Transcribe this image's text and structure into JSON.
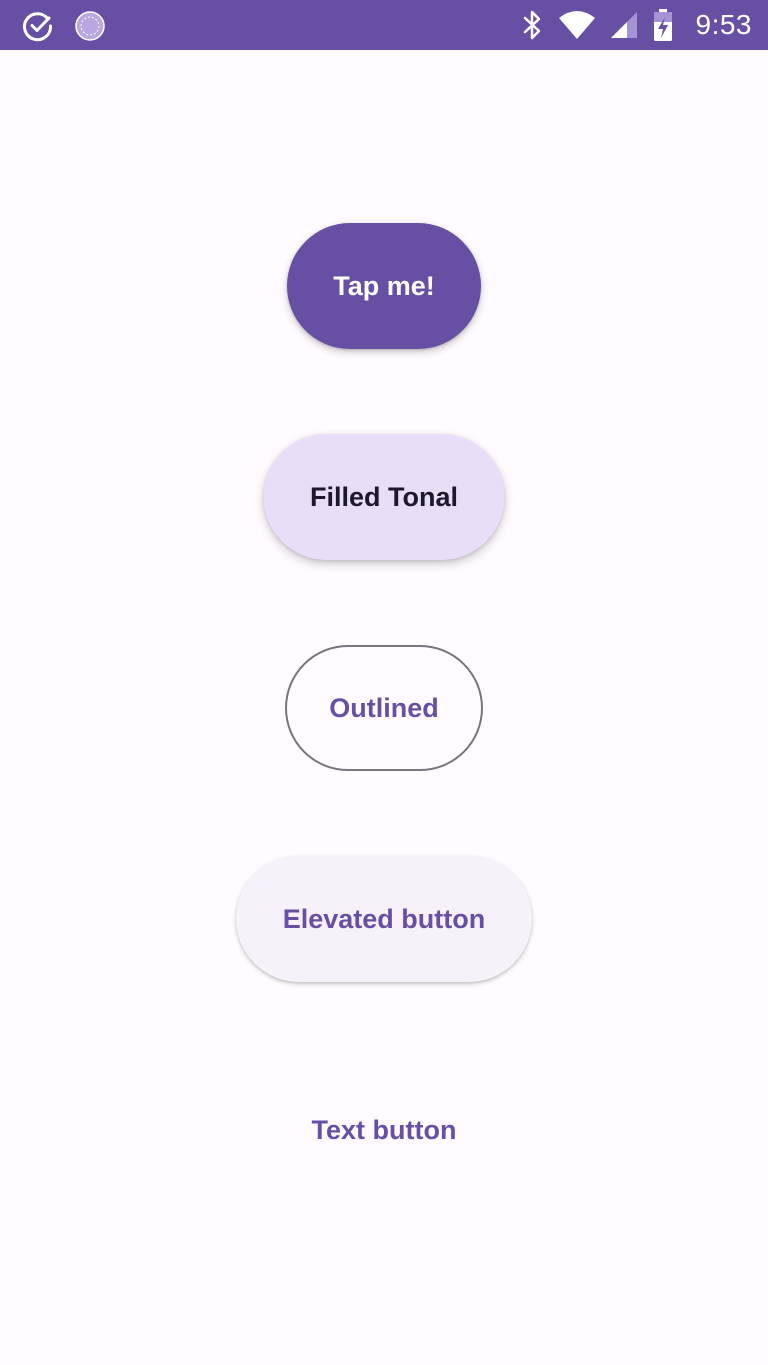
{
  "status_bar": {
    "time": "9:53",
    "left_icons": [
      "check-circle-icon",
      "loading-circle-icon"
    ],
    "right_icons": [
      "bluetooth-icon",
      "wifi-icon",
      "cellular-signal-icon",
      "battery-charging-icon"
    ]
  },
  "buttons": {
    "filled": {
      "label": "Tap me!"
    },
    "tonal": {
      "label": "Filled Tonal"
    },
    "outlined": {
      "label": "Outlined"
    },
    "elevated": {
      "label": "Elevated button"
    },
    "text": {
      "label": "Text button"
    }
  },
  "colors": {
    "primary": "#6750A4",
    "secondary_container": "#E8DEF8",
    "on_secondary_container": "#1D192B",
    "surface": "#FFFBFE",
    "elevated_surface": "#F7F2FA",
    "outline": "#79747E"
  }
}
